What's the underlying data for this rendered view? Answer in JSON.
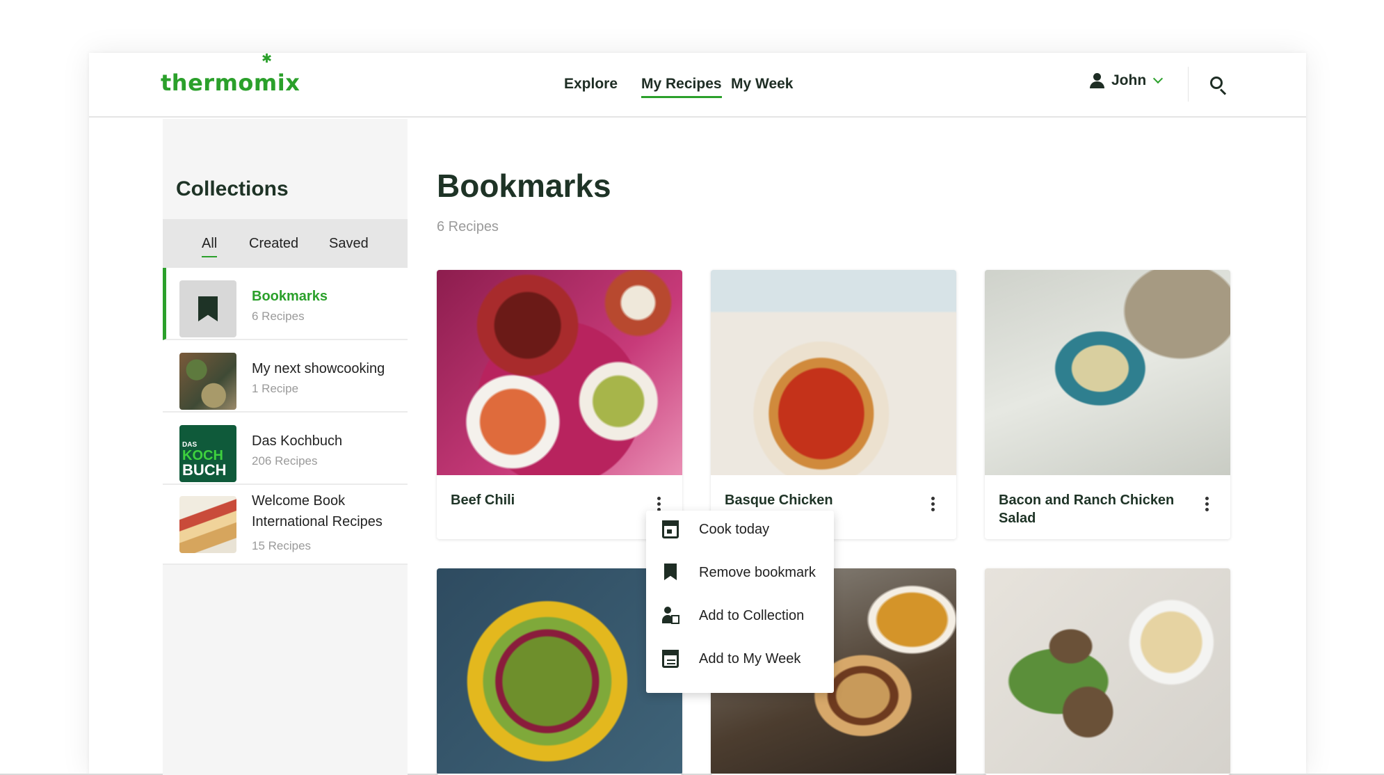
{
  "header": {
    "logo": "thermomix",
    "nav": [
      "Explore",
      "My Recipes",
      "My Week"
    ],
    "active_nav": "My Recipes",
    "user_name": "John",
    "accent_color": "#2ba02b"
  },
  "sidebar": {
    "title": "Collections",
    "filters": [
      "All",
      "Created",
      "Saved"
    ],
    "active_filter": "All",
    "items": [
      {
        "title": "Bookmarks",
        "count": "6 Recipes"
      },
      {
        "title": "My next showcooking",
        "count": "1 Recipe"
      },
      {
        "title": "Das Kochbuch",
        "count": "206 Recipes"
      },
      {
        "title": "Welcome Book International Recipes",
        "count": "15 Recipes"
      }
    ],
    "book_cover": {
      "top": "DAS",
      "koch": "KOCH",
      "buch": "BUCH"
    }
  },
  "main": {
    "title": "Bookmarks",
    "count": "6 Recipes",
    "cards": [
      {
        "title": "Beef Chili"
      },
      {
        "title": "Basque Chicken"
      },
      {
        "title": "Bacon and Ranch Chicken Salad"
      }
    ]
  },
  "context_menu": {
    "items": [
      "Cook today",
      "Remove bookmark",
      "Add to Collection",
      "Add to My Week"
    ]
  }
}
